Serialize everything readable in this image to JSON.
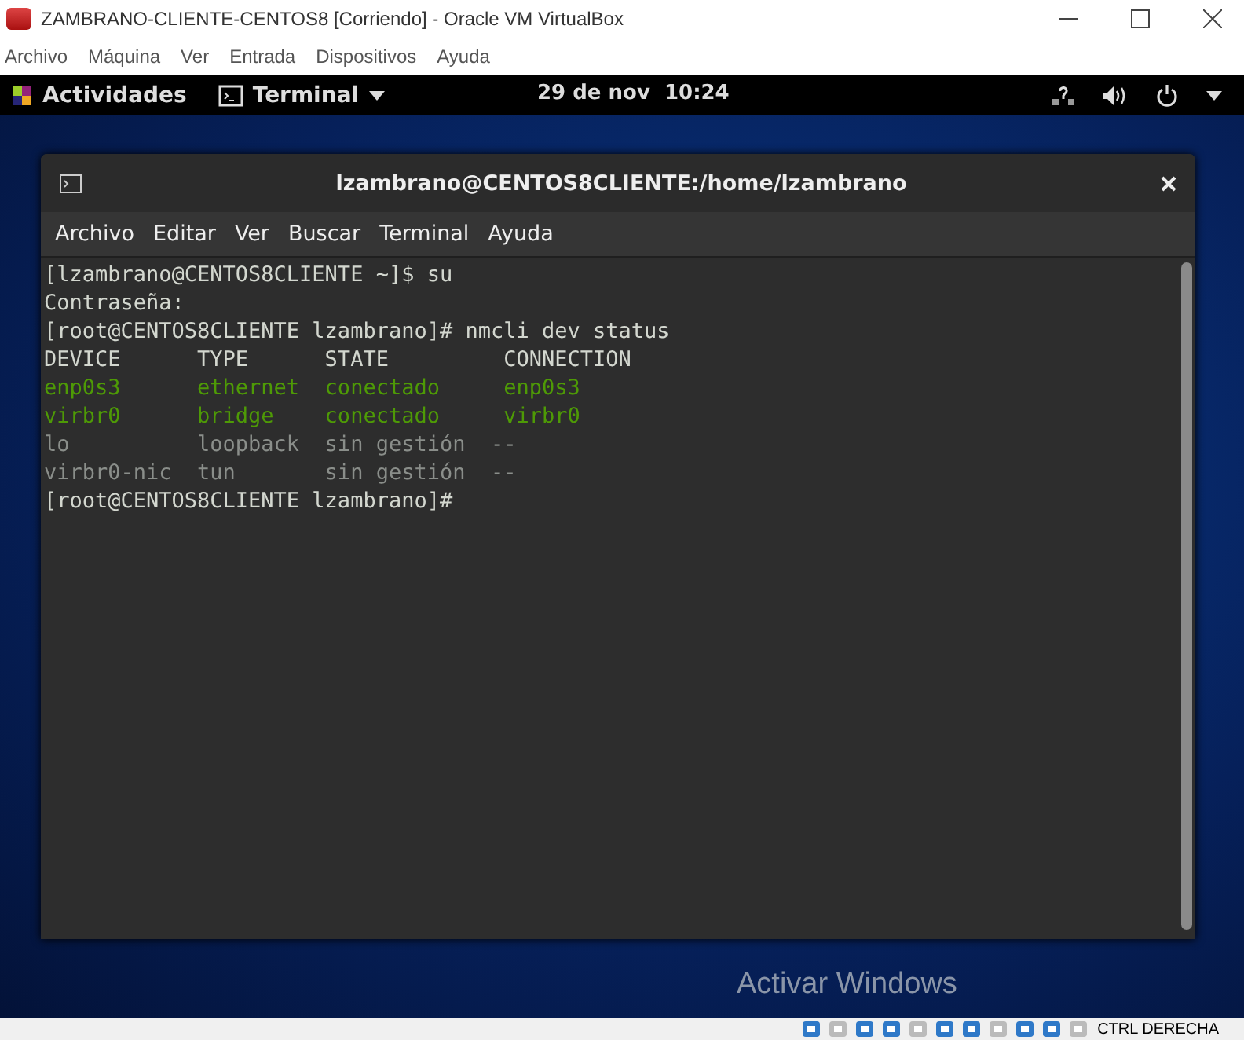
{
  "window": {
    "title": "ZAMBRANO-CLIENTE-CENTOS8 [Corriendo] - Oracle VM VirtualBox"
  },
  "menu": [
    "Archivo",
    "Máquina",
    "Ver",
    "Entrada",
    "Dispositivos",
    "Ayuda"
  ],
  "top_bar": {
    "activities": "Actividades",
    "app": "Terminal",
    "clock": "29 de nov  10:24"
  },
  "terminal": {
    "title": "lzambrano@CENTOS8CLIENTE:/home/lzambrano",
    "menu": [
      "Archivo",
      "Editar",
      "Ver",
      "Buscar",
      "Terminal",
      "Ayuda"
    ],
    "lines": [
      {
        "text": "[lzambrano@CENTOS8CLIENTE ~]$ su",
        "kind": "plain"
      },
      {
        "text": "Contraseña:",
        "kind": "plain"
      },
      {
        "text": "[root@CENTOS8CLIENTE lzambrano]# nmcli dev status",
        "kind": "plain"
      },
      {
        "text": "DEVICE      TYPE      STATE         CONNECTION",
        "kind": "plain"
      },
      {
        "text": "enp0s3      ethernet  conectado     enp0s3",
        "kind": "connected"
      },
      {
        "text": "virbr0      bridge    conectado     virbr0",
        "kind": "connected"
      },
      {
        "text": "lo          loopback  sin gestión  --",
        "kind": "unmanaged"
      },
      {
        "text": "virbr0-nic  tun       sin gestión  --",
        "kind": "unmanaged"
      },
      {
        "text": "[root@CENTOS8CLIENTE lzambrano]#",
        "kind": "plain"
      }
    ]
  },
  "watermark_notice": "Activar Windows",
  "status_bar": {
    "host_key": "CTRL DERECHA"
  }
}
